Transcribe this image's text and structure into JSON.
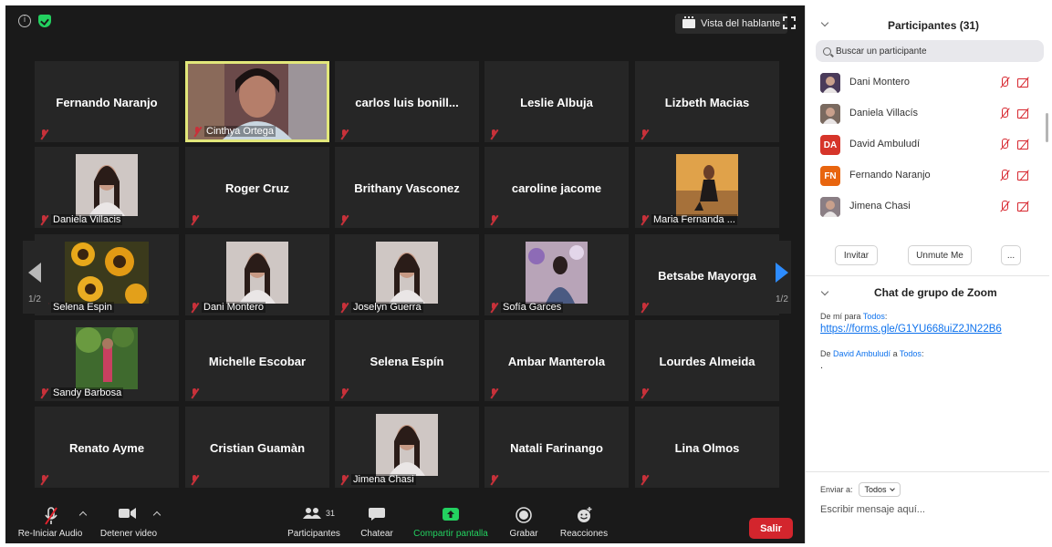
{
  "meeting": {
    "view_label": "Vista del hablante",
    "page_left": "1/2",
    "page_right": "1/2",
    "tiles": [
      {
        "name": "Fernando Naranjo",
        "label": "",
        "photo": ""
      },
      {
        "name": "",
        "label": "Cinthya Ortega",
        "photo": "video"
      },
      {
        "name": "carlos luis bonill...",
        "label": "",
        "photo": ""
      },
      {
        "name": "Leslie Albuja",
        "label": "",
        "photo": ""
      },
      {
        "name": "Lizbeth Macias",
        "label": "",
        "photo": ""
      },
      {
        "name": "",
        "label": "Daniela Villacis",
        "photo": "woman"
      },
      {
        "name": "Roger Cruz",
        "label": "",
        "photo": ""
      },
      {
        "name": "Brithany Vasconez",
        "label": "",
        "photo": ""
      },
      {
        "name": "caroline jacome",
        "label": "",
        "photo": ""
      },
      {
        "name": "",
        "label": "Maria Fernanda ...",
        "photo": "sunset"
      },
      {
        "name": "",
        "label": "Selena Espin",
        "photo": "sunflowers"
      },
      {
        "name": "",
        "label": "Dani Montero",
        "photo": "woman"
      },
      {
        "name": "",
        "label": "Joselyn Guerra",
        "photo": "woman"
      },
      {
        "name": "",
        "label": "Sofía Garces",
        "photo": "balloons"
      },
      {
        "name": "Betsabe Mayorga",
        "label": "",
        "photo": ""
      },
      {
        "name": "",
        "label": "Sandy Barbosa",
        "photo": "garden"
      },
      {
        "name": "Michelle Escobar",
        "label": "",
        "photo": ""
      },
      {
        "name": "Selena Espín",
        "label": "",
        "photo": ""
      },
      {
        "name": "Ambar Manterola",
        "label": "",
        "photo": ""
      },
      {
        "name": "Lourdes Almeida",
        "label": "",
        "photo": ""
      },
      {
        "name": "Renato Ayme",
        "label": "",
        "photo": ""
      },
      {
        "name": "Cristian Guamàn",
        "label": "",
        "photo": ""
      },
      {
        "name": "",
        "label": "Jimena Chasi",
        "photo": "woman"
      },
      {
        "name": "Natali Farinango",
        "label": "",
        "photo": ""
      },
      {
        "name": "Lina Olmos",
        "label": "",
        "photo": ""
      }
    ]
  },
  "toolbar": {
    "audio_label": "Re-Iniciar Audio",
    "video_label": "Detener video",
    "participants_label": "Participantes",
    "participants_count": "31",
    "chat_label": "Chatear",
    "share_label": "Compartir pantalla",
    "record_label": "Grabar",
    "reactions_label": "Reacciones",
    "exit_label": "Salir",
    "share_color": "#23d160",
    "exit_color": "#d3252d"
  },
  "participants_panel": {
    "title": "Participantes (31)",
    "search_placeholder": "Buscar un participante",
    "people": [
      {
        "name": "Dani Montero",
        "initials": "",
        "color": "#4a3b5a"
      },
      {
        "name": "Daniela Villacís",
        "initials": "",
        "color": "#7a6a60"
      },
      {
        "name": "David  Ambuludí",
        "initials": "DA",
        "color": "#d6352a"
      },
      {
        "name": "Fernando Naranjo",
        "initials": "FN",
        "color": "#e8650f"
      },
      {
        "name": "Jimena Chasi",
        "initials": "",
        "color": "#8a7e84"
      }
    ],
    "invite_label": "Invitar",
    "unmute_label": "Unmute Me",
    "more_label": "..."
  },
  "chat_panel": {
    "title": "Chat de grupo de Zoom",
    "msg1_from": "De mí para ",
    "msg1_to": "Todos",
    "msg1_suffix": ":",
    "msg1_link": "https://forms.gle/G1YU668uiZ2JN22B6",
    "msg2_prefix": "De ",
    "msg2_from": "David  Ambuludí",
    "msg2_mid": " a ",
    "msg2_to": "Todos",
    "msg2_suffix": ":",
    "msg2_text": ".",
    "send_to_label": "Enviar a:",
    "send_to_value": "Todos",
    "input_placeholder": "Escribir mensaje aquí..."
  }
}
